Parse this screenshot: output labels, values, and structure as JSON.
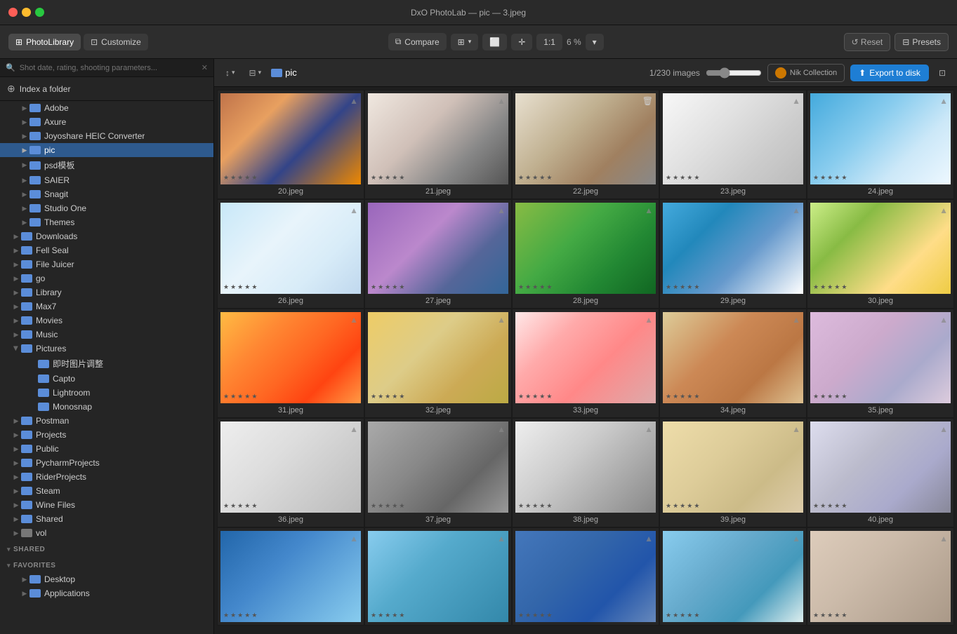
{
  "titleBar": {
    "title": "DxO PhotoLab — pic — 3.jpeg"
  },
  "toolbar": {
    "photoLibraryLabel": "PhotoLibrary",
    "customizeLabel": "Customize",
    "compareLabel": "Compare",
    "zoom1to1Label": "1:1",
    "zoomLevel": "6 %",
    "resetLabel": "Reset",
    "presetsLabel": "Presets"
  },
  "sidebar": {
    "searchPlaceholder": "Shot date, rating, shooting parameters...",
    "indexFolderLabel": "Index a folder",
    "folders": [
      {
        "id": "adobe",
        "label": "Adobe",
        "indent": 2,
        "hasChildren": false
      },
      {
        "id": "axure",
        "label": "Axure",
        "indent": 2,
        "hasChildren": false
      },
      {
        "id": "joyoshare",
        "label": "Joyoshare HEIC Converter",
        "indent": 2,
        "hasChildren": false
      },
      {
        "id": "pic",
        "label": "pic",
        "indent": 2,
        "hasChildren": false,
        "active": true
      },
      {
        "id": "psd",
        "label": "psd模板",
        "indent": 2,
        "hasChildren": false
      },
      {
        "id": "saier",
        "label": "SAIER",
        "indent": 2,
        "hasChildren": false
      },
      {
        "id": "snagit",
        "label": "Snagit",
        "indent": 2,
        "hasChildren": false
      },
      {
        "id": "studioone",
        "label": "Studio One",
        "indent": 2,
        "hasChildren": false
      },
      {
        "id": "themes",
        "label": "Themes",
        "indent": 2,
        "hasChildren": false
      },
      {
        "id": "downloads",
        "label": "Downloads",
        "indent": 1,
        "hasChildren": true
      },
      {
        "id": "fellseal",
        "label": "Fell Seal",
        "indent": 1,
        "hasChildren": false
      },
      {
        "id": "filejuicer",
        "label": "File Juicer",
        "indent": 1,
        "hasChildren": false
      },
      {
        "id": "go",
        "label": "go",
        "indent": 1,
        "hasChildren": false
      },
      {
        "id": "library",
        "label": "Library",
        "indent": 1,
        "hasChildren": false
      },
      {
        "id": "max7",
        "label": "Max7",
        "indent": 1,
        "hasChildren": false
      },
      {
        "id": "movies",
        "label": "Movies",
        "indent": 1,
        "hasChildren": false
      },
      {
        "id": "music",
        "label": "Music",
        "indent": 1,
        "hasChildren": false
      },
      {
        "id": "pictures",
        "label": "Pictures",
        "indent": 1,
        "hasChildren": true,
        "open": true
      },
      {
        "id": "jishi",
        "label": "即时图片调整",
        "indent": 3,
        "hasChildren": false
      },
      {
        "id": "capto",
        "label": "Capto",
        "indent": 3,
        "hasChildren": false
      },
      {
        "id": "lightroom",
        "label": "Lightroom",
        "indent": 3,
        "hasChildren": false
      },
      {
        "id": "monosnap",
        "label": "Monosnap",
        "indent": 3,
        "hasChildren": false
      },
      {
        "id": "postman",
        "label": "Postman",
        "indent": 1,
        "hasChildren": false
      },
      {
        "id": "projects",
        "label": "Projects",
        "indent": 1,
        "hasChildren": false
      },
      {
        "id": "public",
        "label": "Public",
        "indent": 1,
        "hasChildren": false
      },
      {
        "id": "pycharmprojects",
        "label": "PycharmProjects",
        "indent": 1,
        "hasChildren": false
      },
      {
        "id": "riderprojects",
        "label": "RiderProjects",
        "indent": 1,
        "hasChildren": false
      },
      {
        "id": "steam",
        "label": "Steam",
        "indent": 1,
        "hasChildren": false
      },
      {
        "id": "winefiles",
        "label": "Wine Files",
        "indent": 1,
        "hasChildren": false
      },
      {
        "id": "shared",
        "label": "Shared",
        "indent": 1,
        "hasChildren": false
      },
      {
        "id": "vol",
        "label": "vol",
        "indent": 1,
        "hasChildren": false
      }
    ],
    "sections": {
      "shared": "SHARED",
      "favorites": "FAVORITES"
    },
    "favoritesItems": [
      {
        "id": "desktop",
        "label": "Desktop"
      },
      {
        "id": "applications",
        "label": "Applications"
      }
    ]
  },
  "filterBar": {
    "sortIcon": "↕",
    "filterIcon": "⊟",
    "folderName": "pic",
    "imageCount": "1/230 images",
    "nikCollection": "Nik Collection",
    "exportLabel": "Export to disk"
  },
  "photos": [
    {
      "id": "20",
      "label": "20.jpeg",
      "color": "#8B4513",
      "gradient": "linear-gradient(135deg, #c0734a 0%, #e8a060 40%, #2244aa 70%, #ff8800 100%)"
    },
    {
      "id": "21",
      "label": "21.jpeg",
      "color": "#d4a0b0",
      "gradient": "linear-gradient(160deg, #e8d0c0 0%, #c0a090 40%, #888 70%, #555 100%)"
    },
    {
      "id": "22",
      "label": "22.jpeg",
      "color": "#c8b090",
      "gradient": "linear-gradient(160deg, #e0d0c0 0%, #c0b090 40%, #a09070 60%, #888 100%)"
    },
    {
      "id": "23",
      "label": "23.jpeg",
      "color": "#ccc",
      "gradient": "linear-gradient(160deg, #f0f0f0 0%, #e0e0e0 40%, #ccc 70%, #aaa 100%)"
    },
    {
      "id": "24",
      "label": "24.jpeg",
      "color": "#4488cc",
      "gradient": "linear-gradient(160deg, #4488cc 0%, #88aadd 40%, #ccddee 70%, #eef0f8 100%)"
    },
    {
      "id": "26",
      "label": "26.jpeg",
      "color": "#aaccee",
      "gradient": "linear-gradient(160deg, #c8ddf0 0%, #e0eef8 40%, #f0f4f8 60%, #ddeeff 100%)"
    },
    {
      "id": "27",
      "label": "27.jpeg",
      "color": "#6699cc",
      "gradient": "linear-gradient(160deg, #9966aa 0%, #bb88cc 40%, #5577aa 70%, #336699 100%)"
    },
    {
      "id": "28",
      "label": "28.jpeg",
      "color": "#44aa44",
      "gradient": "linear-gradient(160deg, #88bb44 0%, #66aa44 30%, #44aa44 60%, #228833 100%)"
    },
    {
      "id": "29",
      "label": "29.jpeg",
      "color": "#2288cc",
      "gradient": "linear-gradient(160deg, #44aadd 0%, #2288cc 30%, #6699bb 70%, #ffffff 100%)"
    },
    {
      "id": "30",
      "label": "30.jpeg",
      "color": "#88bb44",
      "gradient": "linear-gradient(160deg, #ccee88 0%, #88bb44 30%, #eebb44 70%, #ffdd88 100%)"
    },
    {
      "id": "31",
      "label": "31.jpeg",
      "color": "#ff8833",
      "gradient": "linear-gradient(160deg, #ffaa44 0%, #ff8833 30%, #ff6622 50%, #ee4411 70%, #ff9944 100%)"
    },
    {
      "id": "32",
      "label": "32.jpeg",
      "color": "#ddcc88",
      "gradient": "linear-gradient(160deg, #eecc66 0%, #ddcc88 40%, #ccaa55 70%, #bbaa44 100%)"
    },
    {
      "id": "33",
      "label": "33.jpeg",
      "color": "#ffaaaa",
      "gradient": "linear-gradient(160deg, #ffdddd 0%, #ffaaaa 30%, #ff8888 60%, #ddaaaa 100%)"
    },
    {
      "id": "34",
      "label": "34.jpeg",
      "color": "#cc8855",
      "gradient": "linear-gradient(160deg, #ddcc99 0%, #cc8855 40%, #bb7744 70%, #aa6633 100%)"
    },
    {
      "id": "35",
      "label": "35.jpeg",
      "color": "#ccaacc",
      "gradient": "linear-gradient(160deg, #ddbbdd 0%, #ccaacc 40%, #bbaacc 70%, #aaaacc 100%)"
    },
    {
      "id": "36",
      "label": "36.jpeg",
      "color": "#dddddd",
      "gradient": "linear-gradient(160deg, #eeeeee 0%, #dddddd 40%, #cccccc 70%, #bbbbbb 100%)"
    },
    {
      "id": "37",
      "label": "37.jpeg",
      "color": "#888888",
      "gradient": "linear-gradient(160deg, #aaaaaa 0%, #888888 40%, #666666 70%, #999999 100%)"
    },
    {
      "id": "38",
      "label": "38.jpeg",
      "color": "#cccccc",
      "gradient": "linear-gradient(160deg, #eeeeee 0%, #cccccc 40%, #aaaaaa 70%, #888888 100%)"
    },
    {
      "id": "39",
      "label": "39.jpeg",
      "color": "#ddcc99",
      "gradient": "linear-gradient(160deg, #eeddaa 0%, #ddcc99 40%, #ccbb88 70%, #bbaa77 100%)"
    },
    {
      "id": "40",
      "label": "40.jpeg",
      "color": "#bbbbcc",
      "gradient": "linear-gradient(160deg, #ddddee 0%, #bbbbcc 40%, #aaaacc 70%, #888899 100%)"
    },
    {
      "id": "p1",
      "label": "",
      "color": "#4488cc",
      "gradient": "linear-gradient(160deg, #2266aa 0%, #4488cc 40%, #66aadd 70%, #88ccee 100%)"
    },
    {
      "id": "p2",
      "label": "",
      "color": "#55aacc",
      "gradient": "linear-gradient(160deg, #88ccee 0%, #55aacc 40%, #4499bb 70%, #3388aa 100%)"
    },
    {
      "id": "p3",
      "label": "",
      "color": "#3366aa",
      "gradient": "linear-gradient(160deg, #4477bb 0%, #3366aa 40%, #2255aa 70%, #6688bb 100%)"
    },
    {
      "id": "p4",
      "label": "",
      "color": "#66aacc",
      "gradient": "linear-gradient(160deg, #88ccee 0%, #66aacc 40%, #4499bb 70%, #ddeeee 100%)"
    },
    {
      "id": "p5",
      "label": "",
      "color": "#ccbbaa",
      "gradient": "linear-gradient(160deg, #ddccbb 0%, #ccbbaa 40%, #bbaa99 70%, #aa9988 100%)"
    }
  ]
}
